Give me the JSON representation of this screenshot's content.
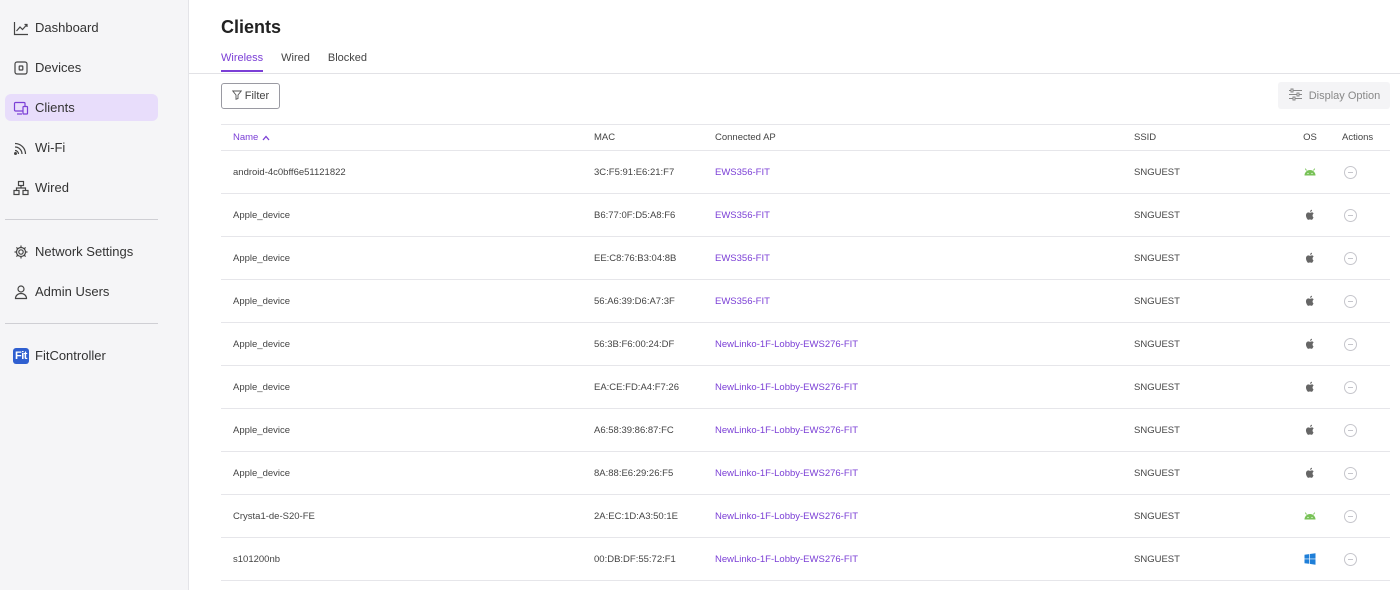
{
  "sidebar": {
    "items": [
      {
        "label": "Dashboard",
        "icon": "chart-line-icon"
      },
      {
        "label": "Devices",
        "icon": "device-icon"
      },
      {
        "label": "Clients",
        "icon": "clients-icon",
        "active": true
      },
      {
        "label": "Wi-Fi",
        "icon": "wifi-icon"
      },
      {
        "label": "Wired",
        "icon": "wired-network-icon"
      },
      {
        "label": "Network Settings",
        "icon": "gear-icon"
      },
      {
        "label": "Admin Users",
        "icon": "user-icon"
      }
    ],
    "brand": {
      "badge": "Fit",
      "label": "FitController"
    }
  },
  "page": {
    "title": "Clients"
  },
  "tabs": [
    {
      "label": "Wireless",
      "active": true
    },
    {
      "label": "Wired"
    },
    {
      "label": "Blocked"
    }
  ],
  "toolbar": {
    "filter_label": "Filter",
    "display_option_label": "Display Option"
  },
  "table": {
    "columns": {
      "name": "Name",
      "mac": "MAC",
      "ap": "Connected AP",
      "ssid": "SSID",
      "os": "OS",
      "actions": "Actions"
    },
    "sort": {
      "column": "name",
      "direction": "ascending"
    },
    "rows": [
      {
        "name": "android-4c0bff6e51121822",
        "mac": "3C:F5:91:E6:21:F7",
        "ap": "EWS356-FIT",
        "ssid": "SNGUEST",
        "os": "android-icon"
      },
      {
        "name": "Apple_device",
        "mac": "B6:77:0F:D5:A8:F6",
        "ap": "EWS356-FIT",
        "ssid": "SNGUEST",
        "os": "apple-icon"
      },
      {
        "name": "Apple_device",
        "mac": "EE:C8:76:B3:04:8B",
        "ap": "EWS356-FIT",
        "ssid": "SNGUEST",
        "os": "apple-icon"
      },
      {
        "name": "Apple_device",
        "mac": "56:A6:39:D6:A7:3F",
        "ap": "EWS356-FIT",
        "ssid": "SNGUEST",
        "os": "apple-icon"
      },
      {
        "name": "Apple_device",
        "mac": "56:3B:F6:00:24:DF",
        "ap": "NewLinko-1F-Lobby-EWS276-FIT",
        "ssid": "SNGUEST",
        "os": "apple-icon"
      },
      {
        "name": "Apple_device",
        "mac": "EA:CE:FD:A4:F7:26",
        "ap": "NewLinko-1F-Lobby-EWS276-FIT",
        "ssid": "SNGUEST",
        "os": "apple-icon"
      },
      {
        "name": "Apple_device",
        "mac": "A6:58:39:86:87:FC",
        "ap": "NewLinko-1F-Lobby-EWS276-FIT",
        "ssid": "SNGUEST",
        "os": "apple-icon"
      },
      {
        "name": "Apple_device",
        "mac": "8A:88:E6:29:26:F5",
        "ap": "NewLinko-1F-Lobby-EWS276-FIT",
        "ssid": "SNGUEST",
        "os": "apple-icon"
      },
      {
        "name": "Crysta1-de-S20-FE",
        "mac": "2A:EC:1D:A3:50:1E",
        "ap": "NewLinko-1F-Lobby-EWS276-FIT",
        "ssid": "SNGUEST",
        "os": "android-icon"
      },
      {
        "name": "s101200nb",
        "mac": "00:DB:DF:55:72:F1",
        "ap": "NewLinko-1F-Lobby-EWS276-FIT",
        "ssid": "SNGUEST",
        "os": "windows-icon"
      }
    ]
  },
  "colors": {
    "accent": "#7b3fd6",
    "active_nav_bg": "#e8ddfb",
    "android": "#78c257",
    "windows": "#1f7fd8",
    "apple": "#666666",
    "brand_badge": "#2f5fd0"
  }
}
